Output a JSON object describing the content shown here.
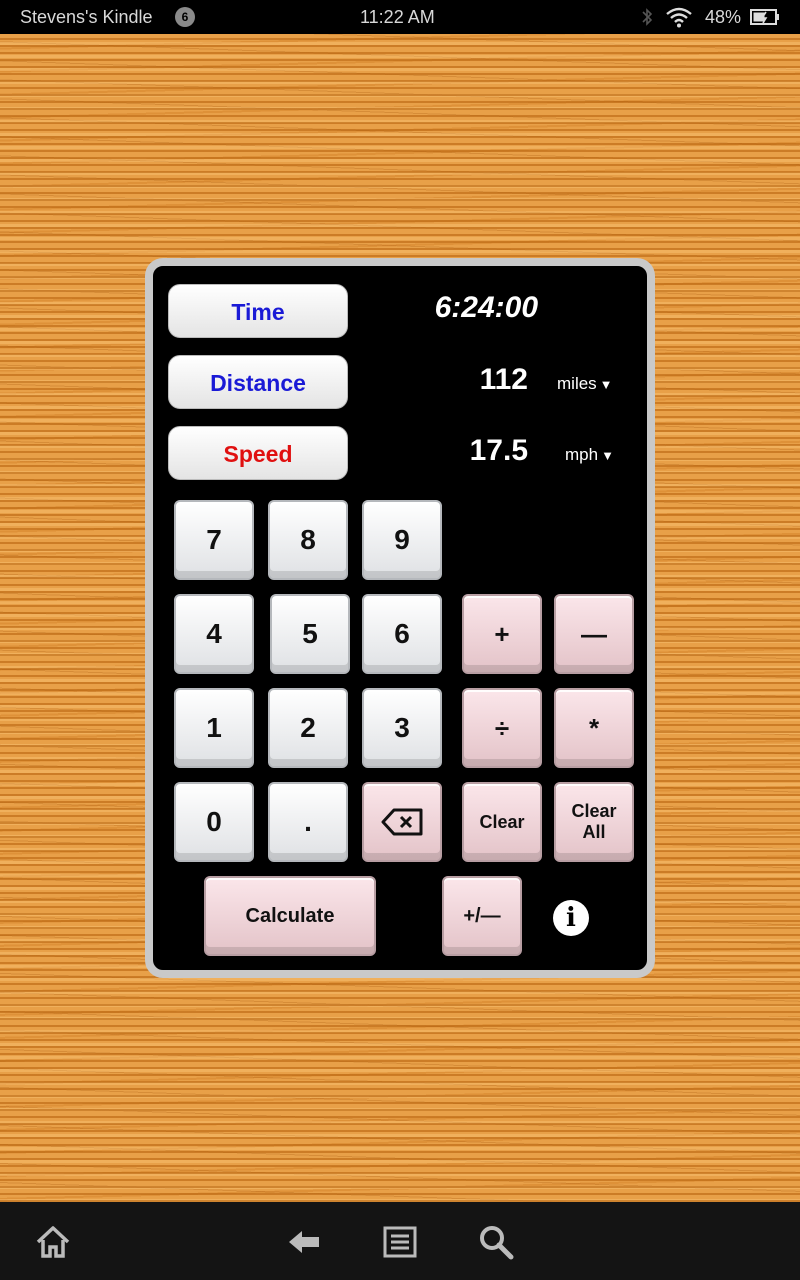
{
  "status_bar": {
    "device_name": "Stevens's Kindle",
    "notification_count": "6",
    "time": "11:22 AM",
    "battery_percent": "48%",
    "icons": [
      "bluetooth-icon",
      "wifi-icon",
      "battery-charging-icon"
    ]
  },
  "calculator": {
    "fields": {
      "time": {
        "label": "Time",
        "value": "6:24:00",
        "color": "#1a1ad6"
      },
      "distance": {
        "label": "Distance",
        "value": "112",
        "unit": "miles",
        "color": "#1a1ad6"
      },
      "speed": {
        "label": "Speed",
        "value": "17.5",
        "unit": "mph",
        "color": "#e01010"
      }
    },
    "dropdown_arrow": "▼",
    "keys": {
      "k7": "7",
      "k8": "8",
      "k9": "9",
      "k4": "4",
      "k5": "5",
      "k6": "6",
      "k1": "1",
      "k2": "2",
      "k3": "3",
      "k0": "0",
      "dot": ".",
      "plus": "+",
      "minus": "—",
      "divide": "÷",
      "multiply": "*",
      "clear": "Clear",
      "clear_all_line1": "Clear",
      "clear_all_line2": "All",
      "calculate": "Calculate",
      "plus_minus": "+/—",
      "info": "i"
    }
  },
  "nav_bar": {
    "icons": [
      "home-icon",
      "back-icon",
      "menu-icon",
      "search-icon"
    ]
  }
}
